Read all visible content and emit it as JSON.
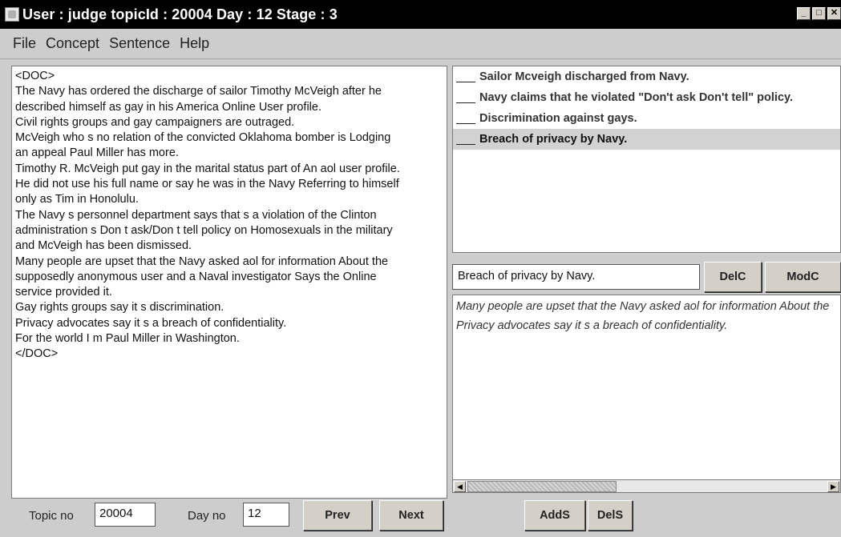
{
  "window": {
    "title": "User : judge topicId : 20004 Day : 12 Stage : 3"
  },
  "menu": [
    "File",
    "Concept",
    "Sentence",
    "Help"
  ],
  "document": {
    "lines": [
      "<DOC>",
      "The Navy has ordered the discharge of sailor Timothy McVeigh after he",
      "described himself as gay in his America Online User profile.",
      "Civil rights groups and gay campaigners are outraged.",
      "McVeigh  who s no relation of the convicted Oklahoma bomber  is Lodging",
      "an appeal Paul Miller has more.",
      "Timothy R. McVeigh put  gay  in the marital status part of An aol user profile.",
      "He did not use his full name or say he was in the Navy  Referring to himself",
      "only as  Tim in Honolulu.",
      "The Navy s personnel department says that s a violation of the Clinton",
      "administration s Don t ask/Don t tell policy on Homosexuals in the military",
      "and McVeigh has been dismissed.",
      "Many people are upset that the Navy asked aol for information About the",
      "supposedly anonymous user and  a Naval investigator Says  the Online",
      "service provided it.",
      "Gay rights groups say it s discrimination.",
      "Privacy advocates say it s a breach of confidentiality.",
      "For  the world   I m Paul Miller in Washington.",
      "</DOC>"
    ]
  },
  "concepts": {
    "items": [
      "Sailor Mcveigh discharged from Navy.",
      "Navy claims that he violated \"Don't ask Don't tell\" policy.",
      "Discrimination against gays.",
      "Breach of privacy by Navy."
    ],
    "selected_index": 3
  },
  "concept_edit": {
    "value": "Breach of privacy by Navy.",
    "delc_label": "DelC",
    "modc_label": "ModC"
  },
  "sentences": {
    "lines": [
      "Many people are upset that the Navy asked aol for information About the",
      "Privacy advocates say it s a breach of confidentiality."
    ],
    "scroll_fraction": 0.4
  },
  "bottom": {
    "topic_label": "Topic no",
    "topic_value": "20004",
    "day_label": "Day no",
    "day_value": "12",
    "prev_label": "Prev",
    "next_label": "Next",
    "adds_label": "AddS",
    "dels_label": "DelS"
  },
  "icons": {
    "app": "app-icon",
    "minimize": "minimize-icon",
    "maximize": "maximize-icon",
    "close": "close-icon"
  }
}
